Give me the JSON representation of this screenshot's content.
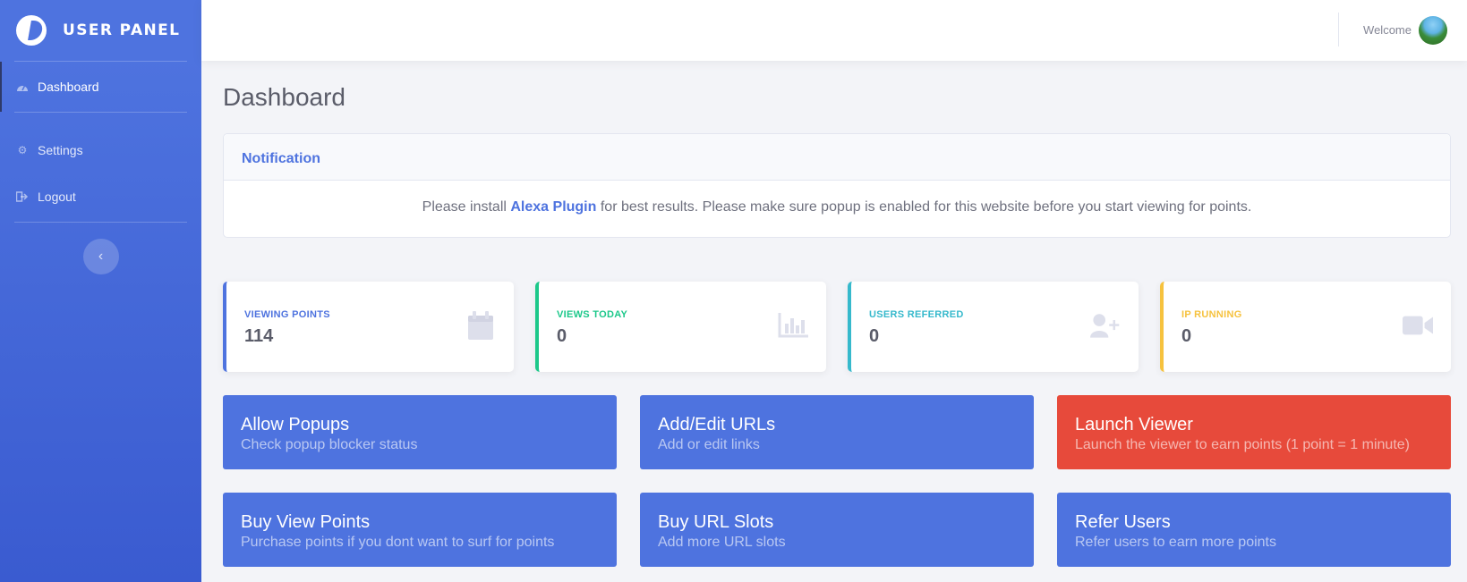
{
  "brand": {
    "title": "USER PANEL"
  },
  "sidebar": {
    "items": [
      {
        "label": "Dashboard",
        "icon": "dashboard-icon"
      },
      {
        "label": "Settings",
        "icon": "gear-icon"
      },
      {
        "label": "Logout",
        "icon": "logout-icon"
      }
    ],
    "toggle_icon": "chevron-left-icon"
  },
  "topbar": {
    "welcome": "Welcome"
  },
  "page": {
    "title": "Dashboard"
  },
  "notification": {
    "header": "Notification",
    "text_before": "Please install ",
    "link": "Alexa Plugin",
    "text_after": " for best results. Please make sure popup is enabled for this website before you start viewing for points."
  },
  "stats": [
    {
      "label": "VIEWING POINTS",
      "value": "114",
      "color": "#4e73df",
      "icon": "calendar-icon"
    },
    {
      "label": "VIEWS TODAY",
      "value": "0",
      "color": "#1cc88a",
      "icon": "chart-icon"
    },
    {
      "label": "USERS REFERRED",
      "value": "0",
      "color": "#36b9cc",
      "icon": "user-plus-icon"
    },
    {
      "label": "IP RUNNING",
      "value": "0",
      "color": "#f6c23e",
      "icon": "video-icon"
    }
  ],
  "actions": [
    {
      "title": "Allow Popups",
      "subtitle": "Check popup blocker status",
      "color": "#4e73df"
    },
    {
      "title": "Add/Edit URLs",
      "subtitle": "Add or edit links",
      "color": "#4e73df"
    },
    {
      "title": "Launch Viewer",
      "subtitle": "Launch the viewer to earn points (1 point = 1 minute)",
      "color": "#e74a3b"
    },
    {
      "title": "Buy View Points",
      "subtitle": "Purchase points if you dont want to surf for points",
      "color": "#4e73df"
    },
    {
      "title": "Buy URL Slots",
      "subtitle": "Add more URL slots",
      "color": "#4e73df"
    },
    {
      "title": "Refer Users",
      "subtitle": "Refer users to earn more points",
      "color": "#4e73df"
    }
  ]
}
